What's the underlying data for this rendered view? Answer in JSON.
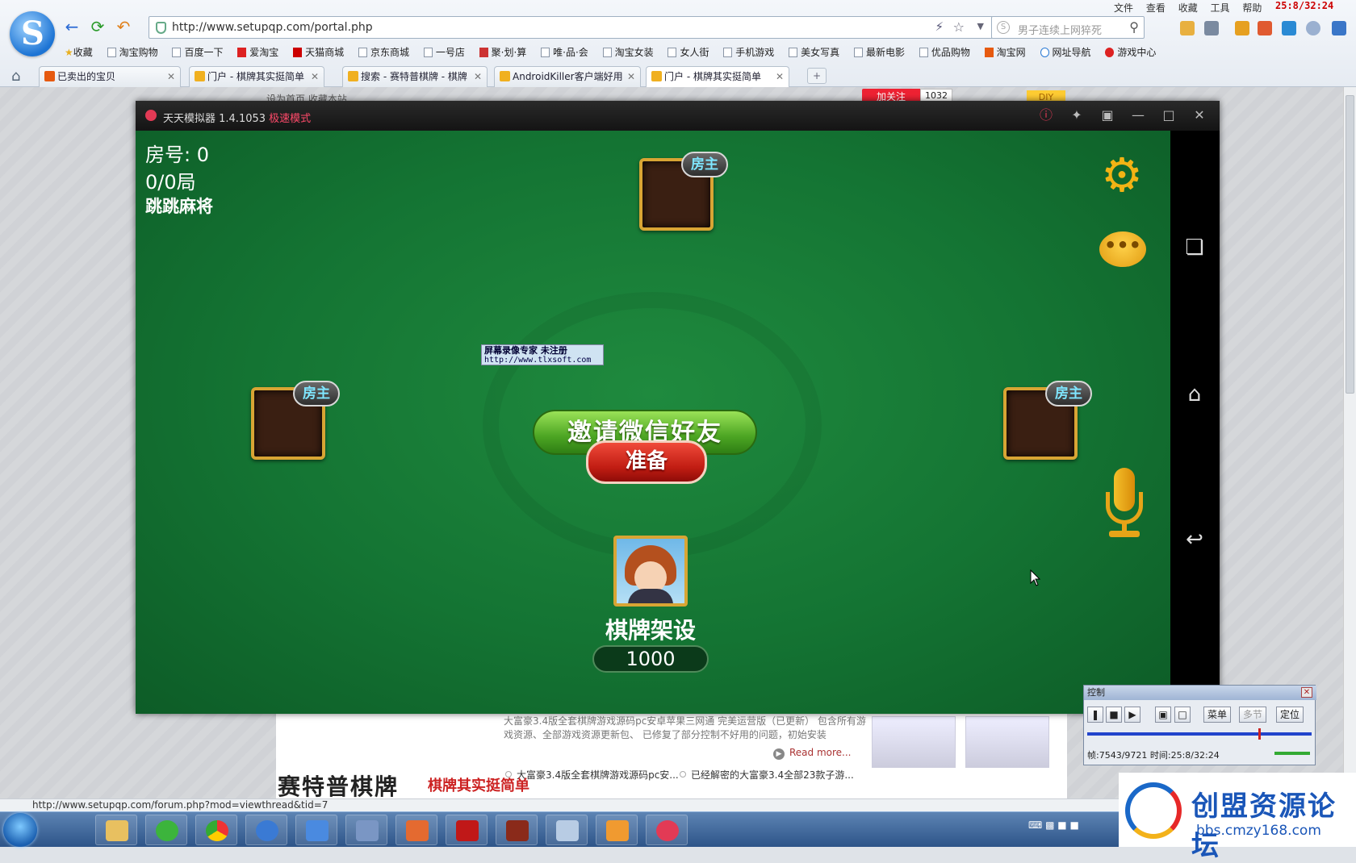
{
  "browser": {
    "url": "http://www.setupqp.com/portal.php",
    "search_placeholder": "男子连续上网猝死",
    "menu": [
      "文件",
      "查看",
      "收藏",
      "工具",
      "帮助"
    ],
    "clock": "25:8/32:24",
    "bookmarks": [
      "收藏",
      "淘宝购物",
      "百度一下",
      "爱淘宝",
      "天猫商城",
      "京东商城",
      "一号店",
      "聚·划·算",
      "唯·品·会",
      "淘宝女装",
      "女人街",
      "手机游戏",
      "美女写真",
      "最新电影",
      "优品购物",
      "淘宝网",
      "网址导航",
      "游戏中心"
    ],
    "tabs": [
      "已卖出的宝贝",
      "门户 - 棋牌其实挺简单",
      "搜索 - 赛特普棋牌 - 棋牌",
      "AndroidKiller客户端好用",
      "门户 - 棋牌其实挺简单"
    ],
    "status_url": "http://www.setupqp.com/forum.php?mod=viewthread&tid=7"
  },
  "page": {
    "header_text": "设为首页  收藏本站",
    "follow_label": "加关注",
    "follow_count": "1032",
    "diy_label": "DIY",
    "news_text": "大富豪3.4版全套棋牌游戏源码pc安卓苹果三网通 完美运营版（已更新） 包含所有游戏资源、全部游戏资源更新包、 已修复了部分控制不好用的问题，初始安装",
    "read_more": "Read more...",
    "news_items": [
      "大富豪3.4版全套棋牌游戏源码pc安...",
      "已经解密的大富豪3.4全部23款子游..."
    ],
    "banner": "赛特普棋牌",
    "banner_sub": "棋牌其实挺简单"
  },
  "emulator": {
    "title": "天天模拟器 1.4.1053",
    "mode": "极速模式"
  },
  "game": {
    "room": "房号: 0",
    "rounds": "0/0局",
    "name": "跳跳麻将",
    "host_badge": "房主",
    "invite_label": "邀请微信好友",
    "ready_label": "准备",
    "player_name": "棋牌架设",
    "player_score": "1000",
    "watermark_title": "屏幕录像专家      未注册",
    "watermark_url": "http://www.tlxsoft.com"
  },
  "recorder": {
    "title": "控制",
    "menu_label": "菜单",
    "multi_label": "多节",
    "locate_label": "定位",
    "info": "帧:7543/9721 时间:25:8/32:24"
  },
  "forum_logo": {
    "name": "创盟资源论坛",
    "url": "bbs.cmzy168.com"
  },
  "icons": [
    "back-icon",
    "refresh-icon",
    "undo-icon",
    "search-icon",
    "star-icon",
    "home-icon",
    "gear-icon",
    "chat-icon",
    "mic-icon",
    "recents-icon",
    "android-home-icon",
    "android-back-icon"
  ]
}
